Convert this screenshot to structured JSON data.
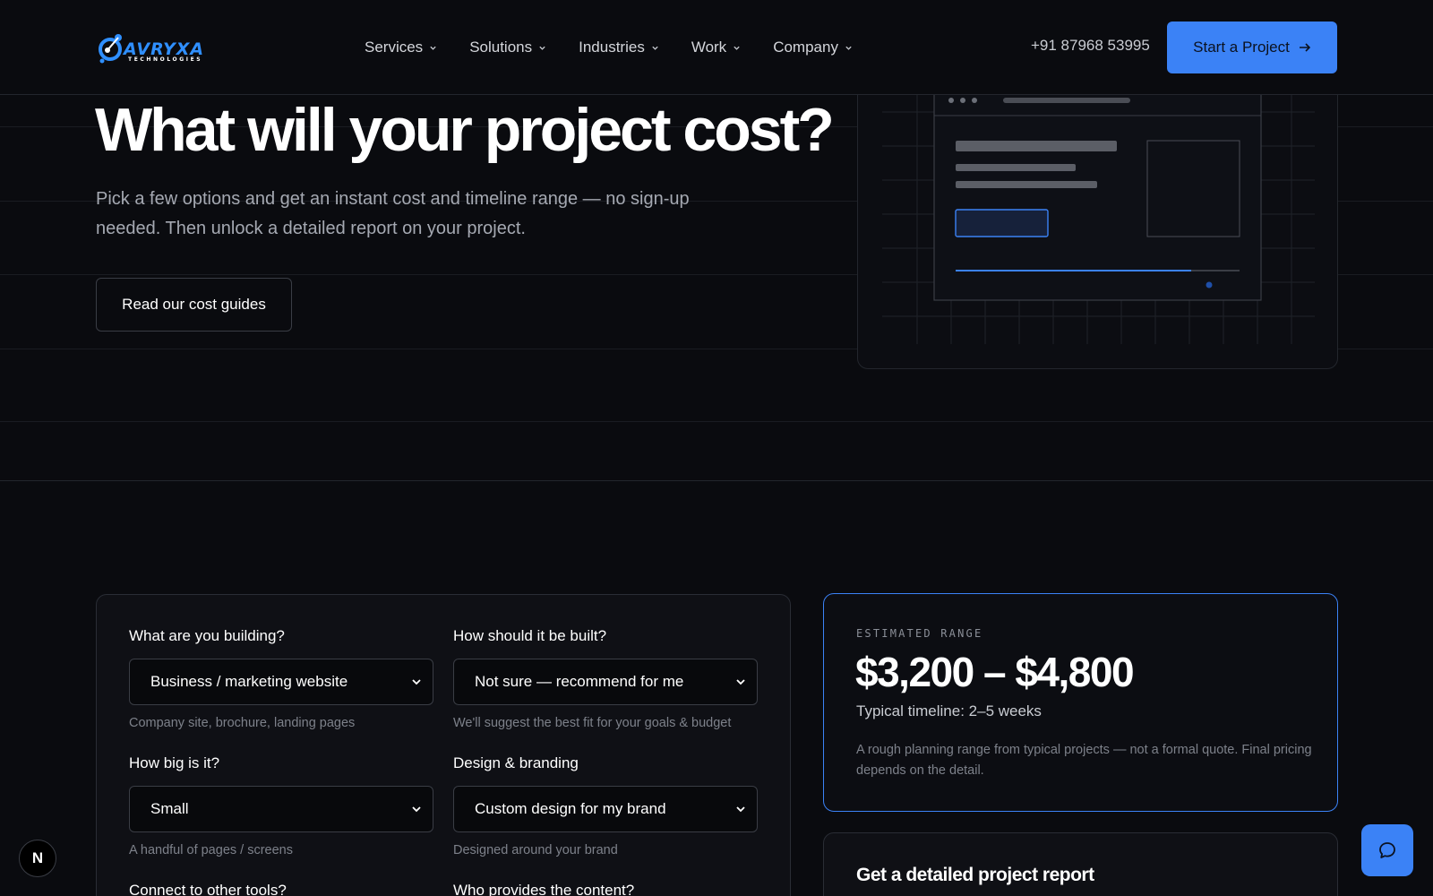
{
  "brand": {
    "name": "AVRYXA",
    "tagline": "TECHNOLOGIES"
  },
  "nav": {
    "items": [
      {
        "label": "Services"
      },
      {
        "label": "Solutions"
      },
      {
        "label": "Industries"
      },
      {
        "label": "Work"
      },
      {
        "label": "Company"
      }
    ],
    "phone": "+91 87968 53995",
    "cta_label": "Start a Project"
  },
  "hero": {
    "title": "What will your project cost?",
    "subtitle": "Pick a few options and get an instant cost and timeline range — no sign-up needed. Then unlock a detailed report on your project.",
    "guide_button": "Read our cost guides"
  },
  "form": {
    "fields": [
      {
        "label": "What are you building?",
        "value": "Business / marketing website",
        "hint": "Company site, brochure, landing pages"
      },
      {
        "label": "How should it be built?",
        "value": "Not sure — recommend for me",
        "hint": "We'll suggest the best fit for your goals & budget"
      },
      {
        "label": "How big is it?",
        "value": "Small",
        "hint": "A handful of pages / screens"
      },
      {
        "label": "Design & branding",
        "value": "Custom design for my brand",
        "hint": "Designed around your brand"
      },
      {
        "label": "Connect to other tools?",
        "value": "",
        "hint": ""
      },
      {
        "label": "Who provides the content?",
        "value": "",
        "hint": ""
      }
    ]
  },
  "estimate": {
    "label": "ESTIMATED RANGE",
    "value": "$3,200 – $4,800",
    "timeline": "Typical timeline: 2–5 weeks",
    "note": "A rough planning range from typical projects — not a formal quote. Final pricing depends on the detail."
  },
  "report": {
    "title": "Get a detailed project report"
  },
  "floating": {
    "next_badge": "N"
  },
  "colors": {
    "accent": "#3b82f6",
    "background": "#0a0b0f",
    "card": "#0f1015"
  },
  "icons": {
    "chevron": "chevron-down-icon",
    "arrow": "arrow-right-icon",
    "chat": "chat-bubble-icon"
  }
}
